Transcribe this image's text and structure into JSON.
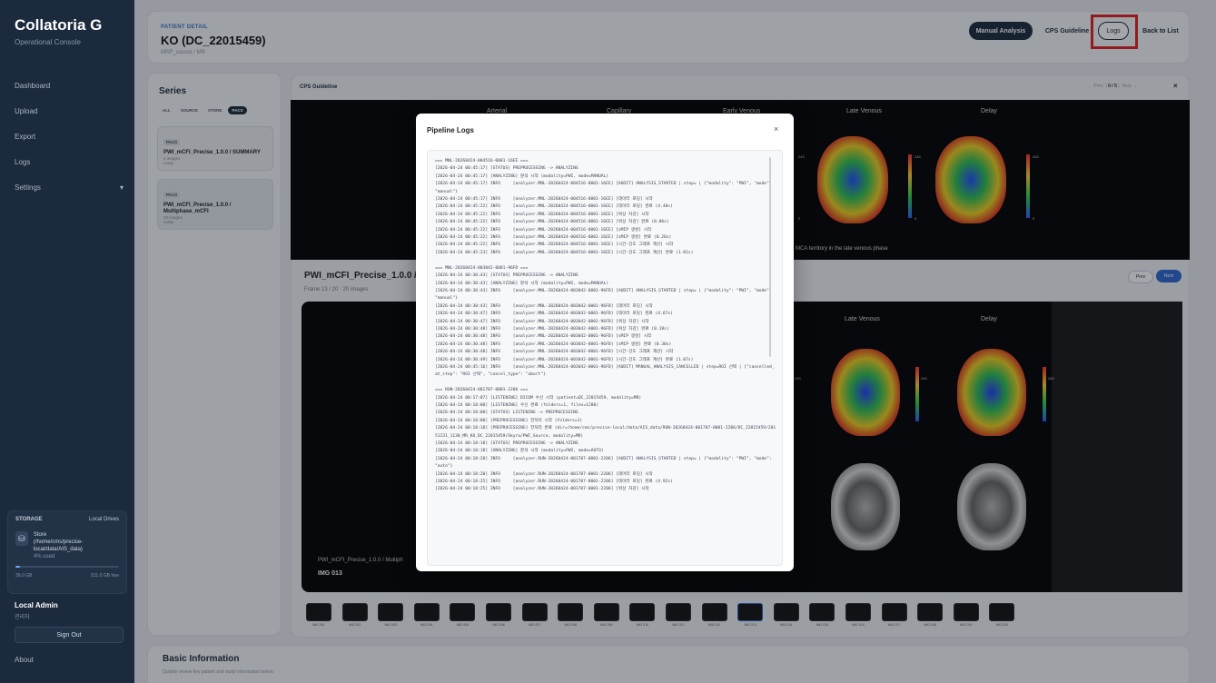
{
  "app": {
    "name": "Collatoria G",
    "subtitle": "Operational Console"
  },
  "sidebar": {
    "items": [
      {
        "label": "Dashboard"
      },
      {
        "label": "Upload"
      },
      {
        "label": "Export"
      },
      {
        "label": "Logs"
      },
      {
        "label": "Settings",
        "chevron": "▾"
      }
    ],
    "storage": {
      "heading": "STORAGE",
      "mode": "Local Drives",
      "name": "Store",
      "path": "(/home/cms/precise-local/data/AIS_data)",
      "used_label": "4% used",
      "used_fraction": 0.04,
      "total": "39.0 GB",
      "free": "511.0 GB free",
      "icon": "drive-icon"
    },
    "user": {
      "name": "Local Admin",
      "role": "관리자"
    },
    "signout": "Sign Out",
    "about": "About"
  },
  "header": {
    "label": "PATIENT DETAIL",
    "title": "KO (DC_22015459)",
    "subtitle": "MRP_source / MR",
    "buttons": {
      "manual": "Manual Analysis",
      "cps": "CPS Guideline",
      "logs": "Logs",
      "back": "Back to List"
    }
  },
  "series": {
    "title": "Series",
    "filters": [
      "ALL",
      "SOURCE",
      "STORE",
      "PACS"
    ],
    "active_filter": "PACS",
    "cards": [
      {
        "badge": "PACS",
        "title": "PWI_mCFI_Precise_1.0.0 / SUMMARY",
        "count": "4 images",
        "status": "ready"
      },
      {
        "badge": "PACS",
        "title": "PWI_mCFI_Precise_1.0.0 / Multiphase_mCFI",
        "count": "20 images",
        "status": "ready"
      }
    ]
  },
  "cps": {
    "label": "CPS Guideline",
    "nav_prev": "← Prev",
    "nav_page": "0 / 5",
    "nav_next": "Next →",
    "phases": [
      "Arterial",
      "Capillary",
      "Early Venous",
      "Late Venous",
      "Delay"
    ],
    "scale_max": "245",
    "scale_min": "0",
    "note": "MCA territory in the late venous phase"
  },
  "viewer": {
    "title": "PWI_mCFI_Precise_1.0.0 /",
    "frame": "Frame 13 / 20 · 20 images",
    "prev": "Prev",
    "next": "Next",
    "phases": [
      "Late Venous",
      "Delay"
    ],
    "scale_max": "245",
    "overlay_desc": "PWI_mCFI_Precise_1.0.0 / Multiph",
    "overlay_img": "IMG 013"
  },
  "thumbnails": [
    "IMG 001",
    "IMG 002",
    "IMG 003",
    "IMG 004",
    "IMG 005",
    "IMG 006",
    "IMG 007",
    "IMG 008",
    "IMG 009",
    "IMG 010",
    "IMG 011",
    "IMG 012",
    "IMG 013",
    "IMG 014",
    "IMG 015",
    "IMG 016",
    "IMG 017",
    "IMG 018",
    "IMG 019",
    "IMG 020"
  ],
  "basic_info": {
    "title": "Basic Information",
    "subtitle": "Quickly review key patient and study information below."
  },
  "modal": {
    "title": "Pipeline Logs",
    "close": "×",
    "log": "=== MNL-20260424-004516-0001-16EE ===\n[2026-04-24 00:45:17] [STATUS] PREPROCESSING -> ANALYZING\n[2026-04-24 00:45:17] [ANALYZING] 분석 시작 (modality=PWI, mode=MANUAL)\n[2026-04-24 00:45:17] INFO     [analyzer.MNL-20260424-004516-0001-16EE] [AUDIT] ANALYSIS_STARTED | step= | {\"modality\": \"PWI\", \"mode\": \"manual\"}\n[2026-04-24 00:45:17] INFO     [analyzer.MNL-20260424-004516-0001-16EE] [데이터 로딩] 시작\n[2026-04-24 00:45:22] INFO     [analyzer.MNL-20260424-004516-0001-16EE] [데이터 로딩] 완료 (4.48s)\n[2026-04-24 00:45:22] INFO     [analyzer.MNL-20260424-004516-0001-16EE] [위상 차감] 시작\n[2026-04-24 00:45:22] INFO     [analyzer.MNL-20260424-004516-0001-16EE] [위상 차감] 완료 (0.06s)\n[2026-04-24 00:45:22] INFO     [analyzer.MNL-20260424-004516-0001-16EE] [sMIP 생성] 시작\n[2026-04-24 00:45:22] INFO     [analyzer.MNL-20260424-004516-0001-16EE] [sMIP 생성] 완료 (0.26s)\n[2026-04-24 00:45:22] INFO     [analyzer.MNL-20260424-004516-0001-16EE] [시간-강도 그래프 계산] 시작\n[2026-04-24 00:45:23] INFO     [analyzer.MNL-20260424-004516-0001-16EE] [시간-강도 그래프 계산] 완료 (1.01s)\n\n=== MNL-20260424-003042-0001-96FD ===\n[2026-04-24 00:30:43] [STATUS] PREPROCESSING -> ANALYZING\n[2026-04-24 00:30:43] [ANALYZING] 분석 시작 (modality=PWI, mode=MANUAL)\n[2026-04-24 00:30:43] INFO     [analyzer.MNL-20260424-003042-0001-96FD] [AUDIT] ANALYSIS_STARTED | step= | {\"modality\": \"PWI\", \"mode\": \"manual\"}\n[2026-04-24 00:30:43] INFO     [analyzer.MNL-20260424-003042-0001-96FD] [데이터 로딩] 시작\n[2026-04-24 00:30:47] INFO     [analyzer.MNL-20260424-003042-0001-96FD] [데이터 로딩] 완료 (4.67s)\n[2026-04-24 00:30:47] INFO     [analyzer.MNL-20260424-003042-0001-96FD] [위상 차감] 시작\n[2026-04-24 00:30:48] INFO     [analyzer.MNL-20260424-003042-0001-96FD] [위상 차감] 완료 (0.18s)\n[2026-04-24 00:30:48] INFO     [analyzer.MNL-20260424-003042-0001-96FD] [sMIP 생성] 시작\n[2026-04-24 00:30:48] INFO     [analyzer.MNL-20260424-003042-0001-96FD] [sMIP 생성] 완료 (0.30s)\n[2026-04-24 00:30:48] INFO     [analyzer.MNL-20260424-003042-0001-96FD] [시간-강도 그래프 계산] 시작\n[2026-04-24 00:30:49] INFO     [analyzer.MNL-20260424-003042-0001-96FD] [시간-강도 그래프 계산] 완료 (1.07s)\n[2026-04-24 00:45:16] INFO     [analyzer.MNL-20260424-003042-0001-96FD] [AUDIT] MANUAL_ANALYSIS_CANCELLED | step=ROI 선택 | {\"cancelled_at_step\": \"ROI 선택\", \"cancel_type\": \"abort\"}\n\n=== RUN-20260424-001707-0001-2206 ===\n[2026-04-24 00:17:07] [LISTENING] DICOM 수신 시작 (patient=DC_22015459, modality=MR)\n[2026-04-24 00:18:00] [LISTENING] 수신 완료 (folders=1, files=1280)\n[2026-04-24 00:18:00] [STATUS] LISTENING -> PREPROCESSING\n[2026-04-24 00:18:00] [PREPROCESSING] 전처리 시작 (folders=1)\n[2026-04-24 00:18:18] [PREPROCESSING] 전처리 완료 (dir=/home/cms/precise-local/data/AIS_data/RUN-20260424-001707-0001-2206/DC_22015459/20151231_1130_MR_KO_DC_22015459/Skyra/PWI_Source, modality=MR)\n[2026-04-24 00:18:18] [STATUS] PREPROCESSING -> ANALYZING\n[2026-04-24 00:18:18] [ANALYZING] 분석 시작 (modality=PWI, mode=AUTO)\n[2026-04-24 00:18:20] INFO     [analyzer.RUN-20260424-001707-0001-2206] [AUDIT] ANALYSIS_STARTED | step= | {\"modality\": \"PWI\", \"mode\": \"auto\"}\n[2026-04-24 00:18:20] INFO     [analyzer.RUN-20260424-001707-0001-2206] [데이터 로딩] 시작\n[2026-04-24 00:18:25] INFO     [analyzer.RUN-20260424-001707-0001-2206] [데이터 로딩] 완료 (4.92s)\n[2026-04-24 00:18:25] INFO     [analyzer.RUN-20260424-001707-0001-2206] [위상 차감] 시작"
  }
}
